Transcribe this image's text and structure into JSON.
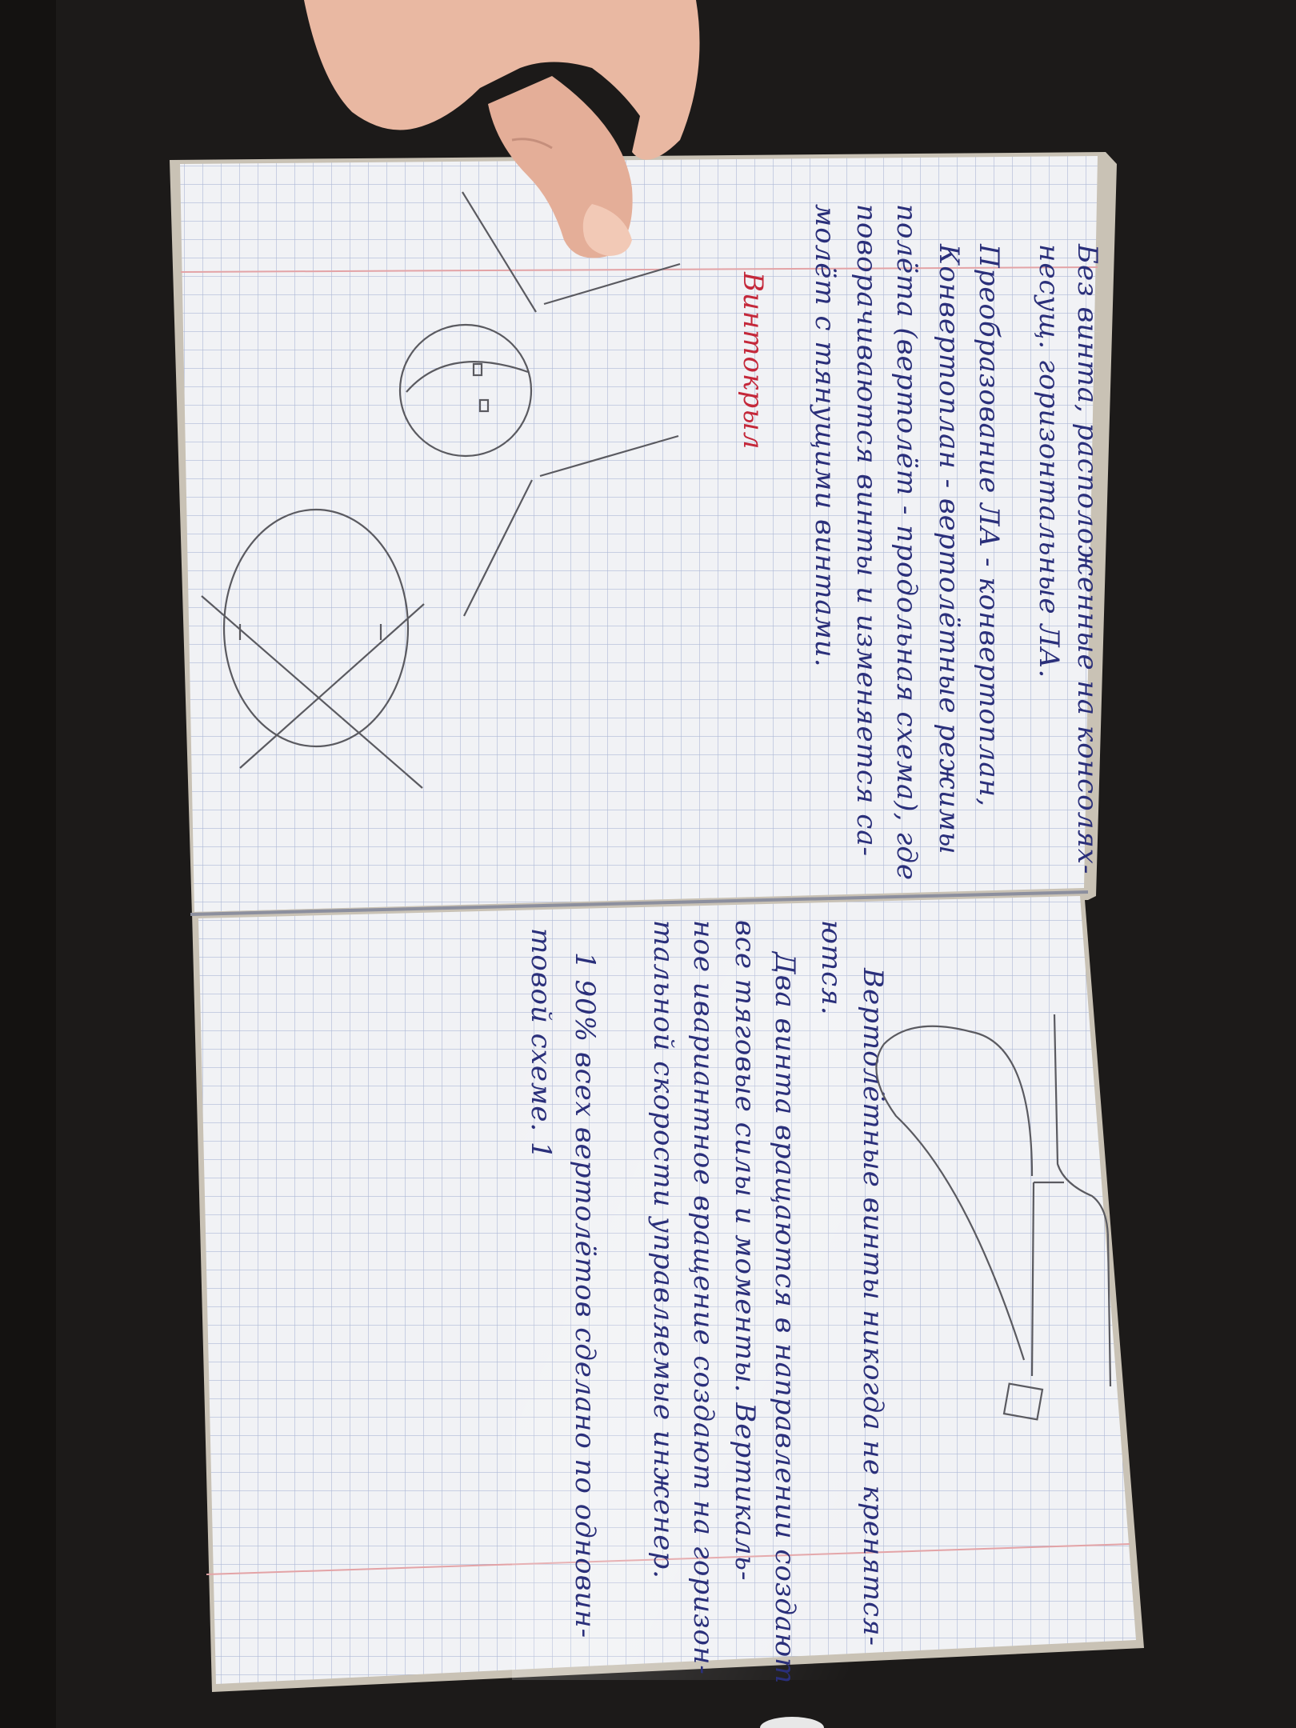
{
  "photo": {
    "subject": "open-squared-notebook",
    "colors": {
      "desk": "#1c1a19",
      "paper": "#f1f2f5",
      "grid": "#aeb8d6",
      "margin_line": "#e3a3a6",
      "ink_blue": "#2a2f7a",
      "ink_red": "#c4283a",
      "pencil": "#5a5a60",
      "skin": "#e9b8a2"
    }
  },
  "notebook": {
    "left_page": {
      "lines": [
        "Без винта, расположенные на консолях-",
        "несущ. горизонтальные ЛА.",
        "Преобразование ЛА - конвертоплан,",
        "Конвертоплан - вертолётные режимы",
        "полёта (вертолёт - продольная схема), где",
        "поворачиваются винты и изменяется са-",
        "молёт с тянущими винтами."
      ],
      "heading_red": "Винтокрыл"
    },
    "right_page": {
      "lines": [
        "Вертолётные винты никогда не кренятся-",
        "ются.",
        "Два винта вращаются в направлении создают",
        "все тяговые силы и моменты. Вертикаль-",
        "ное ивариантное вращение создают на горизон-",
        "тальной скорости управляемые инженер.",
        "1 90% всех вертолётов сделано по одновин-",
        "товой схеме. 1"
      ]
    }
  }
}
